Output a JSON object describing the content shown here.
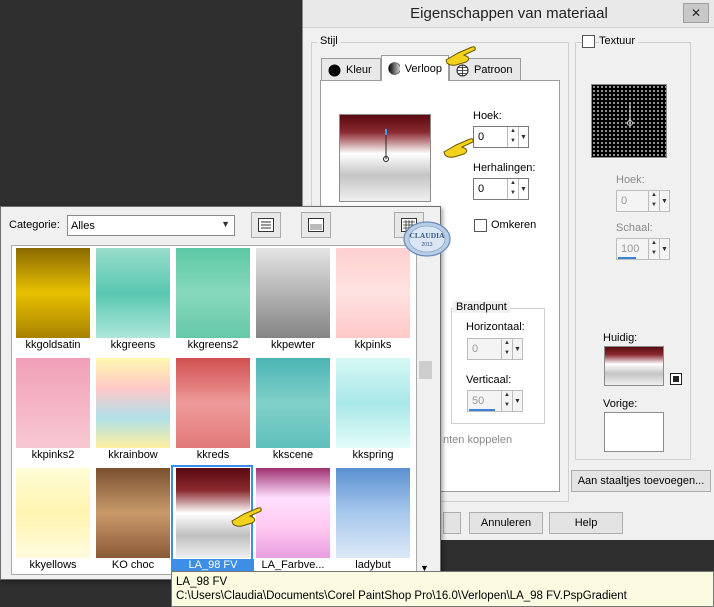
{
  "dialog": {
    "title": "Eigenschappen van materiaal",
    "close_glyph": "✕",
    "style_group": "Stijl",
    "tabs": [
      {
        "label": "Kleur",
        "icon": "black-circle-icon"
      },
      {
        "label": "Verloop",
        "icon": "gradient-circle-icon"
      },
      {
        "label": "Patroon",
        "icon": "globe-grid-icon"
      }
    ],
    "hoek_label": "Hoek:",
    "hoek_value": "0",
    "herhalingen_label": "Herhalingen:",
    "herhalingen_value": "0",
    "omkeren_label": "Omkeren",
    "brandpunt_label": "Brandpunt",
    "horizontaal_label": "Horizontaal:",
    "horizontaal_value": "0",
    "verticaal_label": "Verticaal:",
    "verticaal_value": "50",
    "koppelen_label": "nten koppelen",
    "texture_label": "Textuur",
    "texture_hoek_label": "Hoek:",
    "texture_hoek_value": "0",
    "schaal_label": "Schaal:",
    "schaal_value": "100",
    "huidig_label": "Huidig:",
    "vorige_label": "Vorige:",
    "add_swatch_button": "Aan staaltjes toevoegen...",
    "cancel_button": "Annuleren",
    "help_button": "Help",
    "colors": {
      "accent": "#3d8ee6",
      "tooltip_bg": "#fbfbe2"
    }
  },
  "popup": {
    "category_label": "Categorie:",
    "category_value": "Alles",
    "gradients": [
      {
        "name": "kkgoldsatin",
        "colors": [
          "#8a6a00",
          "#e8c000",
          "#a88200"
        ]
      },
      {
        "name": "kkgreens",
        "colors": [
          "#9adccc",
          "#58c8b0",
          "#aee6da"
        ]
      },
      {
        "name": "kkgreens2",
        "colors": [
          "#5cc8a4",
          "#86d8bc",
          "#66c8a8"
        ]
      },
      {
        "name": "kkpewter",
        "colors": [
          "#e4e4e4",
          "#b4b4b4",
          "#848484"
        ]
      },
      {
        "name": "kkpinks",
        "colors": [
          "#ffd0d0",
          "#ffe2e2",
          "#ffc8c8"
        ]
      },
      {
        "name": "kkpinks2",
        "colors": [
          "#f0a0b8",
          "#f4b4c6",
          "#f8c8d2"
        ]
      },
      {
        "name": "kkrainbow",
        "colors": [
          "#fff8b0",
          "#ffc8c8",
          "#b0e0e8",
          "#fff0a0"
        ]
      },
      {
        "name": "kkreds",
        "colors": [
          "#d05050",
          "#ee9a9a",
          "#e07878"
        ]
      },
      {
        "name": "kkscene",
        "colors": [
          "#4cb4b4",
          "#80d0c8",
          "#60c0bc"
        ]
      },
      {
        "name": "kkspring",
        "colors": [
          "#d8f8f4",
          "#a8e8e8",
          "#e4fbf8"
        ]
      },
      {
        "name": "kkyellows",
        "colors": [
          "#fffcd8",
          "#fff4b0",
          "#fffbe0"
        ]
      },
      {
        "name": "KO choc",
        "colors": [
          "#7a5030",
          "#c89a6a",
          "#8a5a38"
        ]
      },
      {
        "name": "LA_98 FV",
        "colors": [
          "#5a0a10",
          "#8a2a30",
          "#ffffff",
          "#c0c0c0",
          "#f0f0f0"
        ]
      },
      {
        "name": "LA_Farbve...",
        "colors": [
          "#a03070",
          "#ffe0ff",
          "#ffc8f0",
          "#e8a0e0"
        ]
      },
      {
        "name": "ladybut",
        "colors": [
          "#5a90d0",
          "#a8c8ec",
          "#dce8f6"
        ]
      }
    ],
    "selected": "LA_98 FV"
  },
  "tooltip": {
    "name": "LA_98 FV",
    "path": "C:\\Users\\Claudia\\Documents\\Corel PaintShop Pro\\16.0\\Verlopen\\LA_98 FV.PspGradient"
  },
  "watermark": {
    "text": "CLAUDIA",
    "year": "2013"
  }
}
